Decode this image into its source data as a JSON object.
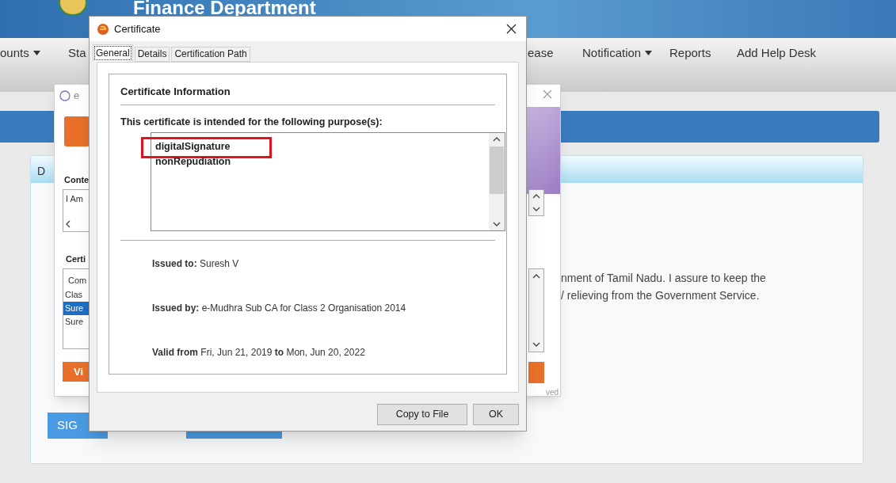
{
  "page": {
    "header_title": "Finance Department",
    "nav": [
      {
        "label": "ounts",
        "dropdown": true
      },
      {
        "label": "Sta",
        "dropdown": false
      },
      {
        "label": "ease",
        "dropdown": false
      },
      {
        "label": "Notification",
        "dropdown": true
      },
      {
        "label": "Reports",
        "dropdown": false
      },
      {
        "label": "Add Help Desk",
        "dropdown": false
      }
    ],
    "panel": {
      "tab_label": "D",
      "text_lines": [
        "nment of Tamil Nadu. I assure to keep the",
        "/ relieving from the Government Service."
      ],
      "sign_button": "SIG"
    }
  },
  "signer_window": {
    "title": "e",
    "content_label": "Conte",
    "content_text": "I Am",
    "cert_label": "Certi",
    "cert_header": "Com",
    "cert_items": [
      {
        "text": "Clas",
        "selected": false
      },
      {
        "text": "Sure",
        "selected": true
      },
      {
        "text": "Sure",
        "selected": false
      }
    ],
    "view_button": "Vi",
    "footer": "ved"
  },
  "certificate_dialog": {
    "title": "Certificate",
    "tabs": [
      {
        "label": "General",
        "selected": true
      },
      {
        "label": "Details",
        "selected": false
      },
      {
        "label": "Certification Path",
        "selected": false
      }
    ],
    "section_title": "Certificate Information",
    "purpose_heading": "This certificate is intended for the following purpose(s):",
    "purposes": [
      {
        "text": "digitalSignature",
        "highlighted": true
      },
      {
        "text": "nonRepudiation",
        "highlighted": false
      }
    ],
    "fields": [
      "**Issued to:** Suresh V",
      "**Issued by:** e-Mudhra Sub CA for Class 2 Organisation 2014",
      "**Valid from** Fri, Jun 21, 2019 **to** Mon, Jun 20, 2022"
    ],
    "buttons": [
      "Copy to File",
      "OK"
    ]
  }
}
